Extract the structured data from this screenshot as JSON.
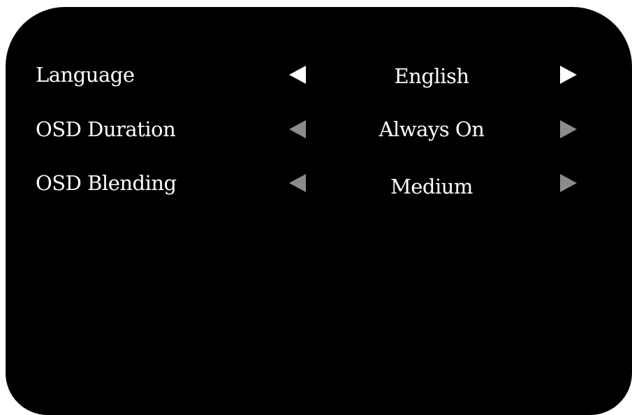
{
  "osd_menu": {
    "colors": {
      "background": "#000000",
      "text": "#ffffff",
      "active_arrow": "#ffffff",
      "inactive_arrow": "#8c8c8c"
    },
    "rows": [
      {
        "label": "Language",
        "value": "English",
        "selected": true,
        "left_icon": "triangle-left-icon",
        "right_icon": "triangle-right-icon"
      },
      {
        "label": "OSD Duration",
        "value": "Always On",
        "selected": false,
        "left_icon": "triangle-left-icon",
        "right_icon": "triangle-right-icon"
      },
      {
        "label": "OSD Blending",
        "value": "Medium",
        "selected": false,
        "left_icon": "triangle-left-icon",
        "right_icon": "triangle-right-icon"
      }
    ]
  }
}
